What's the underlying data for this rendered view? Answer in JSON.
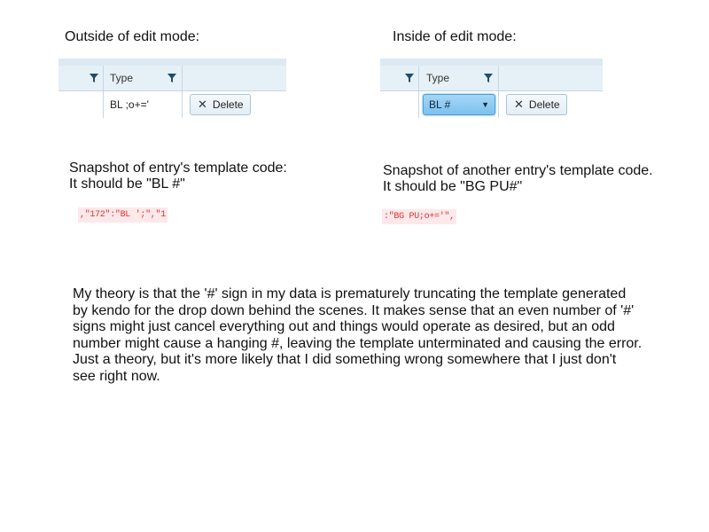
{
  "left": {
    "heading": "Outside of edit mode:",
    "grid": {
      "column_header": "Type",
      "cell_value": "BL ;o+='",
      "delete_label": "Delete"
    },
    "caption_line1": "Snapshot of entry's template code:",
    "caption_line2": "It should be \"BL #\"",
    "snippet": ",\"172\":\"BL ';\",\"1"
  },
  "right": {
    "heading": "Inside of edit mode:",
    "grid": {
      "column_header": "Type",
      "dropdown_value": "BL #",
      "delete_label": "Delete"
    },
    "caption_line1": "Snapshot of another entry's template code.",
    "caption_line2": "It should be \"BG PU#\"",
    "snippet": ":\"BG PU;o+='\","
  },
  "theory": {
    "lines": [
      "My theory is that the '#' sign in my data is prematurely truncating the template generated",
      "by kendo for the drop down behind the scenes.  It makes sense that an even number of '#'",
      "signs might just cancel everything out and things would operate as desired, but an odd",
      "number might cause a hanging #, leaving the template unterminated and causing the error.",
      "Just a theory, but it's more likely that I did something wrong somewhere that I just don't",
      "see right now."
    ]
  },
  "colors": {
    "header_bg": "#e6f0f7",
    "grid_line": "#c5d6e3",
    "dropdown_accent": "#7cc1ee",
    "snippet_bg": "#fde8ea",
    "snippet_text": "#d33333"
  }
}
